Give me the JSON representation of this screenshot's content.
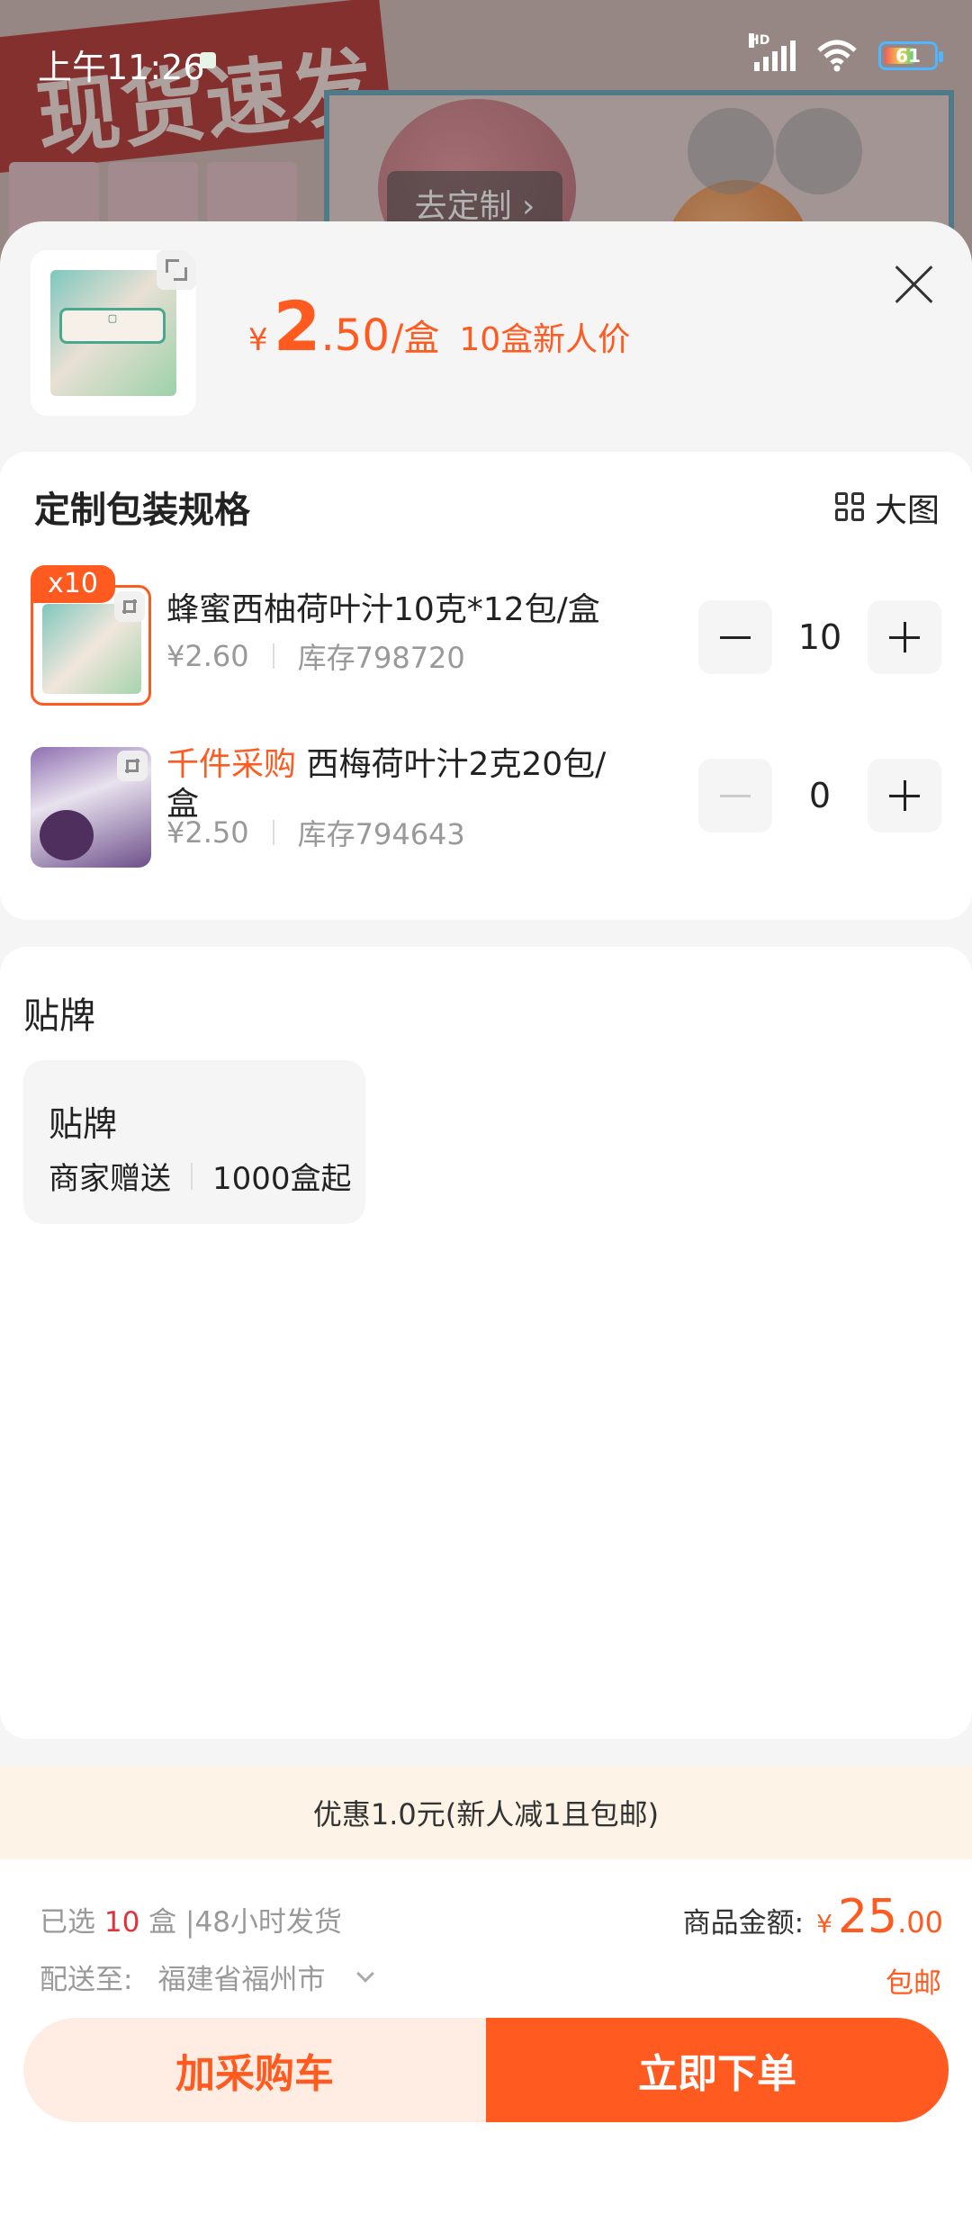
{
  "status_bar": {
    "time": "上午11:26",
    "hd_label": "HD",
    "battery": "61"
  },
  "background": {
    "banner_text": "现货速发",
    "cta_label": "去定制 ›"
  },
  "product": {
    "price_currency": "¥",
    "price_integer": "2",
    "price_decimal": ".50",
    "price_unit": "/盒",
    "price_tag": "10盒新人价"
  },
  "spec": {
    "title": "定制包装规格",
    "big_view_label": "大图",
    "items": [
      {
        "badge": "x10",
        "highlight": "",
        "name": "蜂蜜西柚荷叶汁10克*12包/盒",
        "price": "¥2.60",
        "stock": "库存798720",
        "quantity": "10",
        "selected": true
      },
      {
        "badge": "",
        "highlight": "千件采购",
        "name": " 西梅荷叶汁2克20包/盒",
        "price": "¥2.50",
        "stock": "库存794643",
        "quantity": "0",
        "selected": false
      }
    ]
  },
  "label": {
    "title": "贴牌",
    "option_title": "贴牌",
    "option_source": "商家赠送",
    "option_moq": "1000盒起"
  },
  "promo": {
    "text": "优惠1.0元(新人减1且包邮)"
  },
  "summary": {
    "selected_prefix": "已选",
    "selected_count": "10",
    "selected_suffix": "盒 |48小时发货",
    "deliver_label": "配送至:",
    "deliver_region": "福建省福州市",
    "total_label": "商品金额:",
    "total_currency": "¥",
    "total_integer": "25",
    "total_decimal": ".00",
    "shipping": "包邮"
  },
  "actions": {
    "add_cart": "加采购车",
    "buy_now": "立即下单"
  },
  "colors": {
    "accent": "#ff5a1f",
    "promo_bg": "#fdf3e6",
    "cart_btn_bg": "#ffede3"
  }
}
